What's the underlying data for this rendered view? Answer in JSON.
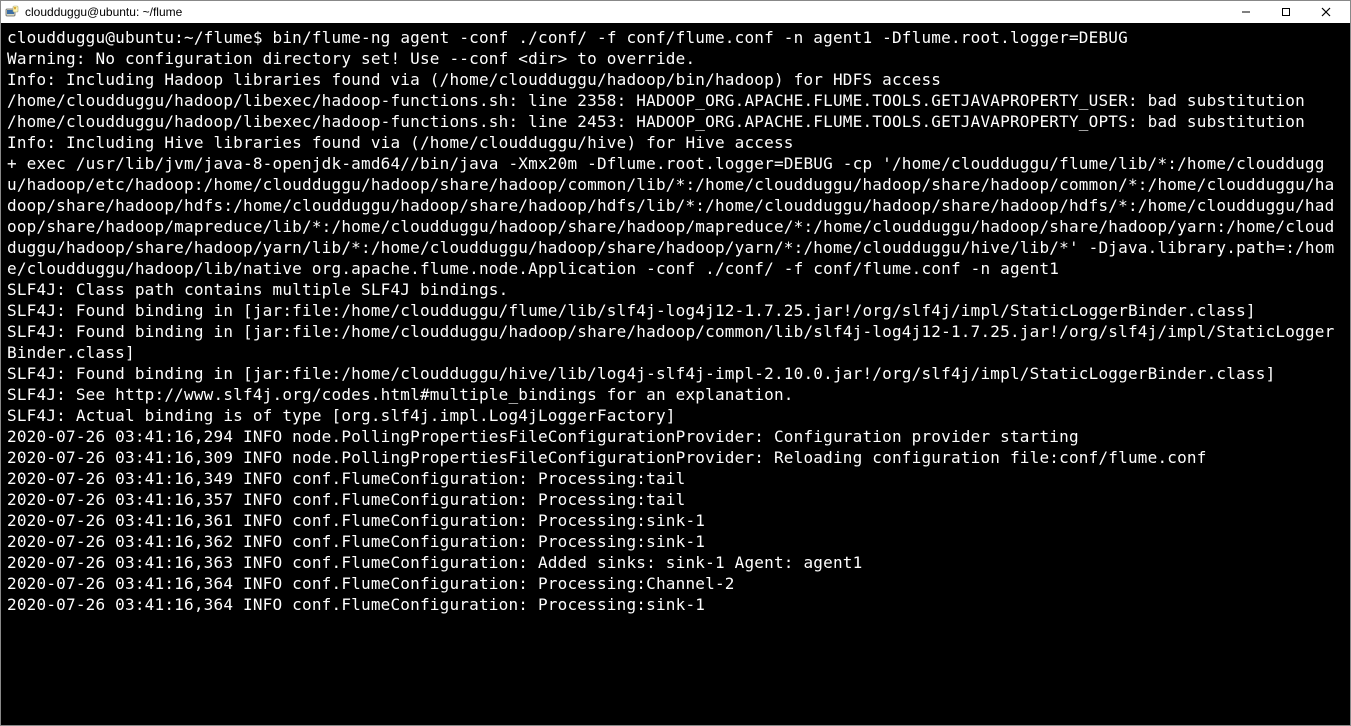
{
  "window": {
    "title": "cloudduggu@ubuntu: ~/flume"
  },
  "prompt": "cloudduggu@ubuntu:~/flume$",
  "command": "bin/flume-ng agent -conf ./conf/ -f conf/flume.conf -n agent1 -Dflume.root.logger=DEBUG",
  "lines": [
    "Warning: No configuration directory set! Use --conf <dir> to override.",
    "Info: Including Hadoop libraries found via (/home/cloudduggu/hadoop/bin/hadoop) for HDFS access",
    "/home/cloudduggu/hadoop/libexec/hadoop-functions.sh: line 2358: HADOOP_ORG.APACHE.FLUME.TOOLS.GETJAVAPROPERTY_USER: bad substitution",
    "/home/cloudduggu/hadoop/libexec/hadoop-functions.sh: line 2453: HADOOP_ORG.APACHE.FLUME.TOOLS.GETJAVAPROPERTY_OPTS: bad substitution",
    "Info: Including Hive libraries found via (/home/cloudduggu/hive) for Hive access",
    "+ exec /usr/lib/jvm/java-8-openjdk-amd64//bin/java -Xmx20m -Dflume.root.logger=DEBUG -cp '/home/cloudduggu/flume/lib/*:/home/cloudduggu/hadoop/etc/hadoop:/home/cloudduggu/hadoop/share/hadoop/common/lib/*:/home/cloudduggu/hadoop/share/hadoop/common/*:/home/cloudduggu/hadoop/share/hadoop/hdfs:/home/cloudduggu/hadoop/share/hadoop/hdfs/lib/*:/home/cloudduggu/hadoop/share/hadoop/hdfs/*:/home/cloudduggu/hadoop/share/hadoop/mapreduce/lib/*:/home/cloudduggu/hadoop/share/hadoop/mapreduce/*:/home/cloudduggu/hadoop/share/hadoop/yarn:/home/cloudduggu/hadoop/share/hadoop/yarn/lib/*:/home/cloudduggu/hadoop/share/hadoop/yarn/*:/home/cloudduggu/hive/lib/*' -Djava.library.path=:/home/cloudduggu/hadoop/lib/native org.apache.flume.node.Application -conf ./conf/ -f conf/flume.conf -n agent1",
    "SLF4J: Class path contains multiple SLF4J bindings.",
    "SLF4J: Found binding in [jar:file:/home/cloudduggu/flume/lib/slf4j-log4j12-1.7.25.jar!/org/slf4j/impl/StaticLoggerBinder.class]",
    "SLF4J: Found binding in [jar:file:/home/cloudduggu/hadoop/share/hadoop/common/lib/slf4j-log4j12-1.7.25.jar!/org/slf4j/impl/StaticLoggerBinder.class]",
    "SLF4J: Found binding in [jar:file:/home/cloudduggu/hive/lib/log4j-slf4j-impl-2.10.0.jar!/org/slf4j/impl/StaticLoggerBinder.class]",
    "SLF4J: See http://www.slf4j.org/codes.html#multiple_bindings for an explanation.",
    "SLF4J: Actual binding is of type [org.slf4j.impl.Log4jLoggerFactory]",
    "2020-07-26 03:41:16,294 INFO node.PollingPropertiesFileConfigurationProvider: Configuration provider starting",
    "2020-07-26 03:41:16,309 INFO node.PollingPropertiesFileConfigurationProvider: Reloading configuration file:conf/flume.conf",
    "2020-07-26 03:41:16,349 INFO conf.FlumeConfiguration: Processing:tail",
    "2020-07-26 03:41:16,357 INFO conf.FlumeConfiguration: Processing:tail",
    "2020-07-26 03:41:16,361 INFO conf.FlumeConfiguration: Processing:sink-1",
    "2020-07-26 03:41:16,362 INFO conf.FlumeConfiguration: Processing:sink-1",
    "2020-07-26 03:41:16,363 INFO conf.FlumeConfiguration: Added sinks: sink-1 Agent: agent1",
    "2020-07-26 03:41:16,364 INFO conf.FlumeConfiguration: Processing:Channel-2",
    "2020-07-26 03:41:16,364 INFO conf.FlumeConfiguration: Processing:sink-1"
  ]
}
